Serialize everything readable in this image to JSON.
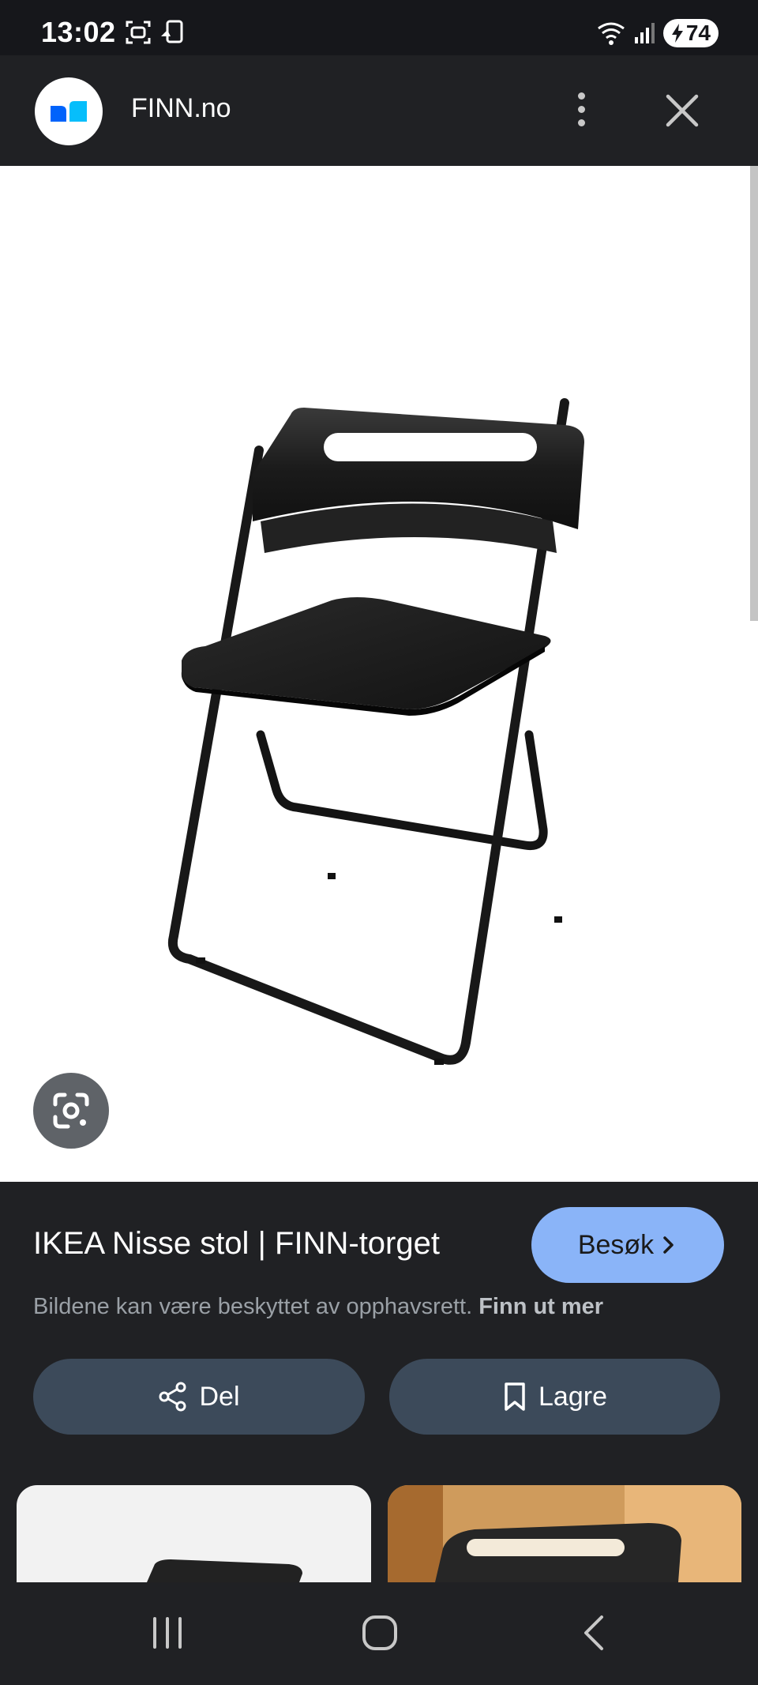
{
  "status_bar": {
    "time": "13:02",
    "battery": "74"
  },
  "app_bar": {
    "site_name": "FINN.no"
  },
  "result": {
    "title": "IKEA Nisse stol | FINN-torget",
    "visit_label": "Besøk",
    "copyright_text": "Bildene kan være beskyttet av opphavsrett.",
    "learn_more": "Finn ut mer",
    "share_label": "Del",
    "save_label": "Lagre"
  },
  "colors": {
    "accent": "#8ab4f8",
    "pill": "#3c4a5a",
    "background": "#202124"
  }
}
